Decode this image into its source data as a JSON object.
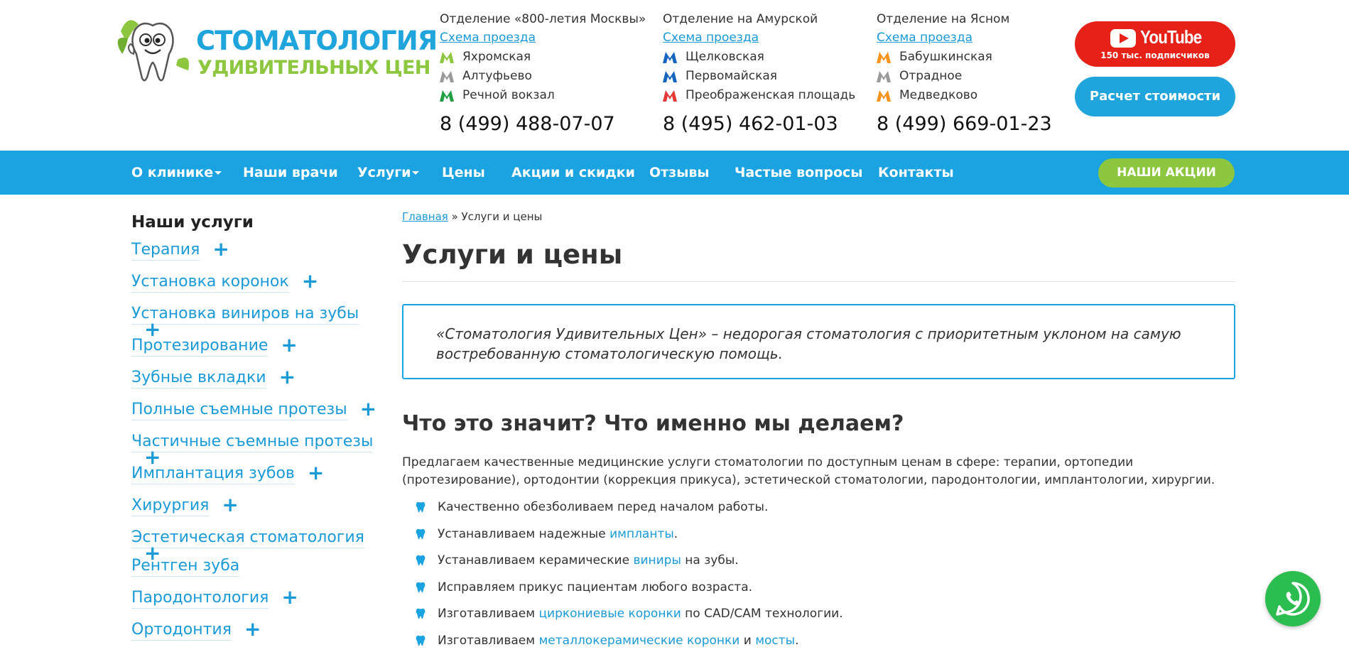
{
  "logo": {
    "line1": "СТОМАТОЛОГИЯ",
    "line2": "УДИВИТЕЛЬНЫХ ЦЕН"
  },
  "branches": [
    {
      "title": "Отделение «800-летия Москвы»",
      "map_link": "Схема проезда",
      "metro": [
        {
          "name": "Яхромская",
          "color": "#8dc63f"
        },
        {
          "name": "Алтуфьево",
          "color": "#9a9a9a"
        },
        {
          "name": "Речной вокзал",
          "color": "#22a045"
        }
      ],
      "phone": "8 (499) 488-07-07"
    },
    {
      "title": "Отделение на Амурской",
      "map_link": "Схема проезда",
      "metro": [
        {
          "name": "Щелковская",
          "color": "#1565c0"
        },
        {
          "name": "Первомайская",
          "color": "#1565c0"
        },
        {
          "name": "Преображенская площадь",
          "color": "#e53935"
        }
      ],
      "phone": "8 (495) 462-01-03"
    },
    {
      "title": "Отделение на Ясном",
      "map_link": "Схема проезда",
      "metro": [
        {
          "name": "Бабушкинская",
          "color": "#f7941d"
        },
        {
          "name": "Отрадное",
          "color": "#9a9a9a"
        },
        {
          "name": "Медведково",
          "color": "#f7941d"
        }
      ],
      "phone": "8 (499) 669-01-23"
    }
  ],
  "youtube": {
    "name": "YouTube",
    "subs": "150 тыс. подписчиков"
  },
  "calc_button": "Расчет стоимости",
  "nav": {
    "items": [
      "О клинике",
      "Наши врачи",
      "Услуги",
      "Цены",
      "Акции и скидки",
      "Отзывы",
      "Частые вопросы",
      "Контакты"
    ],
    "promo": "НАШИ АКЦИИ"
  },
  "sidebar": {
    "title": "Наши услуги",
    "items": [
      "Терапия",
      "Установка коронок",
      "Установка виниров на зубы",
      "Протезирование",
      "Зубные вкладки",
      "Полные съемные протезы",
      "Частичные съемные протезы",
      "Имплантация зубов",
      "Хирургия",
      "Эстетическая стоматология",
      "Рентген зуба",
      "Пародонтология",
      "Ортодонтия"
    ]
  },
  "breadcrumb": {
    "home": "Главная",
    "sep": " » ",
    "current": "Услуги и цены"
  },
  "page_title": "Услуги и цены",
  "quote": "«Стоматология Удивительных Цен» – недорогая стоматология с приоритетным уклоном на самую востребованную стоматологическую помощь.",
  "section_title": "Что это значит? Что именно мы делаем?",
  "intro": "Предлагаем качественные медицинские услуги стоматологии по доступным ценам в сфере: терапии, ортопедии (протезирование), ортодонтии (коррекция прикуса), эстетической стоматологии, пародонтологии, имплантологии, хирургии.",
  "benefits": [
    {
      "pre": "Качественно обезболиваем перед началом работы."
    },
    {
      "pre": "Устанавливаем надежные ",
      "link": "импланты",
      "post": "."
    },
    {
      "pre": "Устанавливаем керамические ",
      "link": "виниры",
      "post": " на зубы."
    },
    {
      "pre": "Исправляем прикус пациентам любого возраста."
    },
    {
      "pre": "Изготавливаем ",
      "link": "циркониевые коронки",
      "post": " по CAD/CAM технологии."
    },
    {
      "pre": "Изготавливаем ",
      "link": "металлокерамические коронки",
      "mid": " и ",
      "link2": "мосты",
      "post": "."
    }
  ],
  "colors": {
    "accent": "#1aa3e0",
    "green": "#8dc63f",
    "youtube": "#e62117",
    "whatsapp": "#2bbd4f"
  }
}
